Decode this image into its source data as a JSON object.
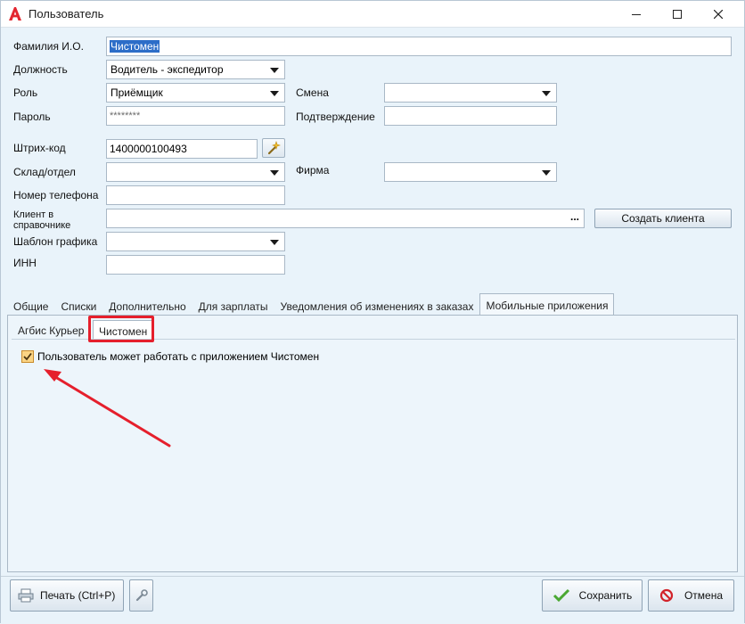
{
  "window": {
    "title": "Пользователь",
    "controls": [
      "minimize-icon",
      "maximize-icon",
      "close-icon"
    ]
  },
  "form": {
    "fio_label": "Фамилия И.О.",
    "fio_value": "Чистомен",
    "position_label": "Должность",
    "position_value": "Водитель - экспедитор",
    "role_label": "Роль",
    "role_value": "Приёмщик",
    "shift_label": "Смена",
    "shift_value": "",
    "password_label": "Пароль",
    "password_value": "********",
    "confirm_label": "Подтверждение",
    "confirm_value": "",
    "barcode_label": "Штрих-код",
    "barcode_value": "1400000100493",
    "warehouse_label": "Склад/отдел",
    "warehouse_value": "",
    "firm_label": "Фирма",
    "firm_value": "",
    "phone_label": "Номер телефона",
    "phone_value": "",
    "client_label_line1": "Клиент в",
    "client_label_line2": "справочнике",
    "client_value": "",
    "client_ellipsis": "...",
    "create_client_label": "Создать клиента",
    "schedule_label": "Шаблон графика",
    "schedule_value": "",
    "inn_label": "ИНН",
    "inn_value": ""
  },
  "tabs": [
    {
      "label": "Общие"
    },
    {
      "label": "Списки"
    },
    {
      "label": "Дополнительно"
    },
    {
      "label": "Для зарплаты"
    },
    {
      "label": "Уведомления об изменениях в заказах"
    },
    {
      "label": "Мобильные приложения",
      "active": true
    }
  ],
  "subtabs": [
    {
      "label": "Агбис Курьер"
    },
    {
      "label": "Чистомен",
      "active": true
    }
  ],
  "mobile": {
    "checkbox_checked": true,
    "checkbox_label": "Пользователь может работать с приложением Чистомен"
  },
  "footer": {
    "print_label": "Печать (Ctrl+P)",
    "save_label": "Сохранить",
    "cancel_label": "Отмена"
  },
  "colors": {
    "annotation": "#e51f2c",
    "selection": "#2c6dc8",
    "logo": "#e3262f"
  }
}
